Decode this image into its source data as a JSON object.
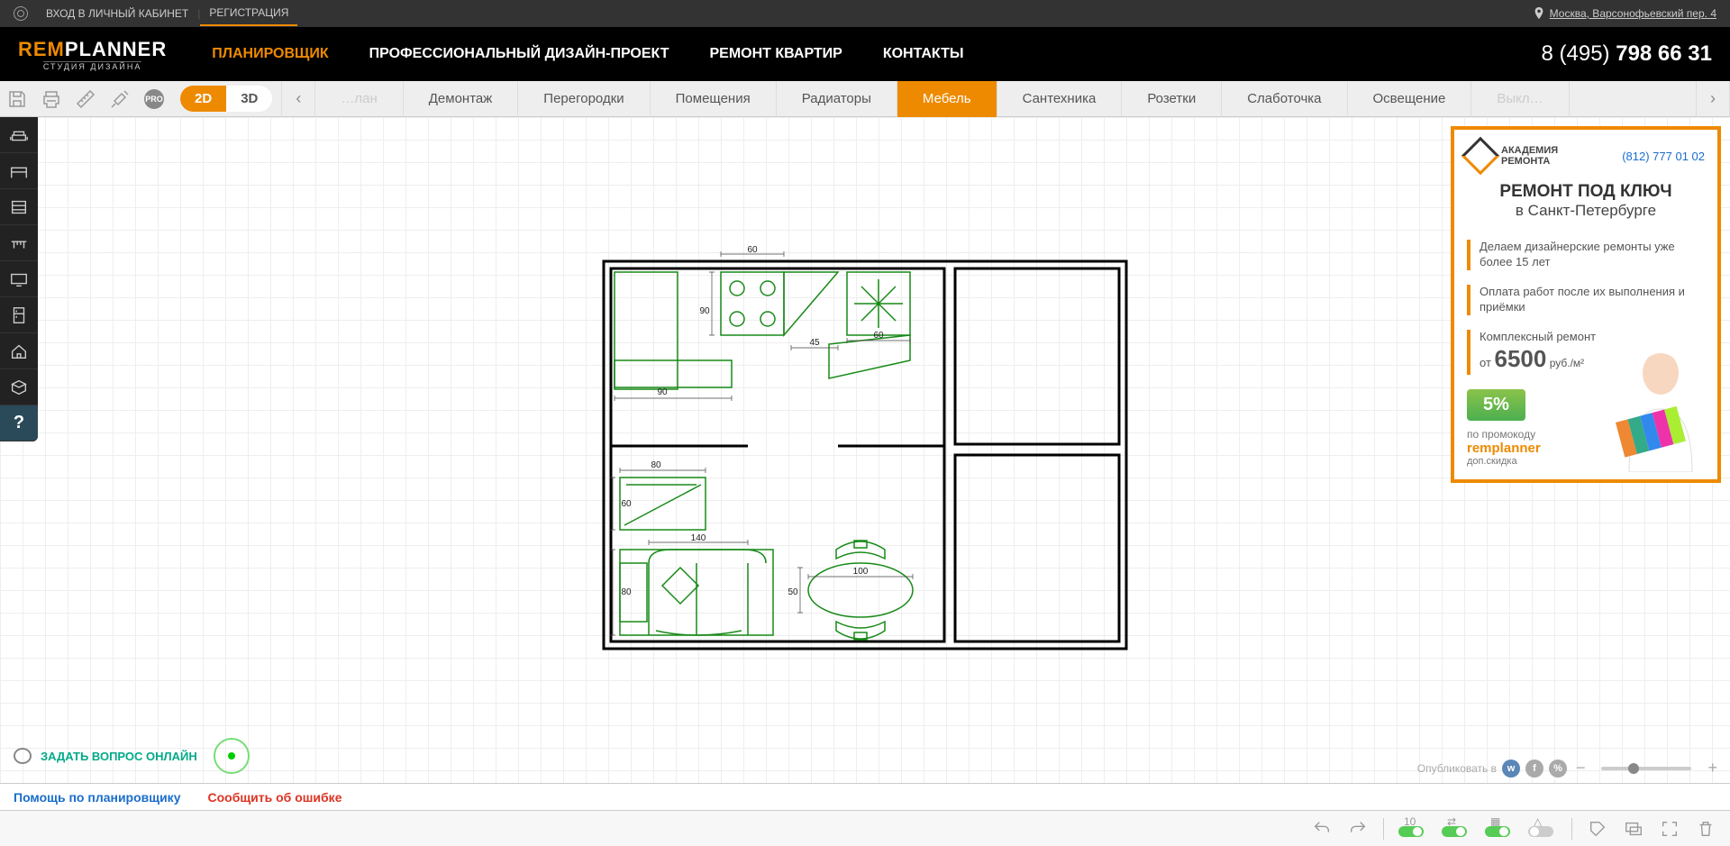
{
  "topbar": {
    "login": "ВХОД В ЛИЧНЫЙ КАБИНЕТ",
    "register": "РЕГИСТРАЦИЯ",
    "location": "Москва, Варсонофьевский пер. 4"
  },
  "logo": {
    "rem": "REM",
    "planner": "PLANNER",
    "sub": "СТУДИЯ ДИЗАЙНА"
  },
  "nav": {
    "planner": "ПЛАНИРОВЩИК",
    "design": "ПРОФЕССИОНАЛЬНЫЙ ДИЗАЙН-ПРОЕКТ",
    "renov": "РЕМОНТ КВАРТИР",
    "contacts": "КОНТАКТЫ",
    "phone_prefix": "8 (495) ",
    "phone_main": "798 66 31"
  },
  "view": {
    "v2d": "2D",
    "v3d": "3D"
  },
  "tabs": {
    "t0": "…лан",
    "t1": "Демонтаж",
    "t2": "Перегородки",
    "t3": "Помещения",
    "t4": "Радиаторы",
    "t5": "Мебель",
    "t6": "Сантехника",
    "t7": "Розетки",
    "t8": "Слаботочка",
    "t9": "Освещение",
    "t10": "Выкл…"
  },
  "toolbar_icons": {
    "pro": "PRO"
  },
  "floorplan": {
    "dims": {
      "d60": "60",
      "d90a": "90",
      "d90b": "90",
      "d45": "45",
      "d60b": "60",
      "d80a": "80",
      "d60c": "60",
      "d140": "140",
      "d80b": "80",
      "d100": "100",
      "d50": "50"
    }
  },
  "ad": {
    "brand1": "АКАДЕМИЯ",
    "brand2": "РЕМОНТА",
    "phone": "(812) 777 01 02",
    "title": "РЕМОНТ ПОД КЛЮЧ",
    "sub": "в Санкт-Петербурге",
    "line1": "Делаем дизайнерские ремонты уже более 15 лет",
    "line2": "Оплата работ после их выполнения и приёмки",
    "line3_a": "Комплексный ремонт",
    "line3_from": "от ",
    "line3_price": "6500",
    "line3_unit": " руб./м²",
    "discount": "5%",
    "promo_label": "по промокоду",
    "promo_code": "remplanner",
    "promo_extra": "доп.скидка"
  },
  "chat": {
    "label": "ЗАДАТЬ ВОПРОС ОНЛАЙН"
  },
  "publish": {
    "label": "Опубликовать в"
  },
  "footer": {
    "help": "Помощь по планировщику",
    "error": "Сообщить об ошибке"
  },
  "toggles": {
    "t10": "10"
  }
}
